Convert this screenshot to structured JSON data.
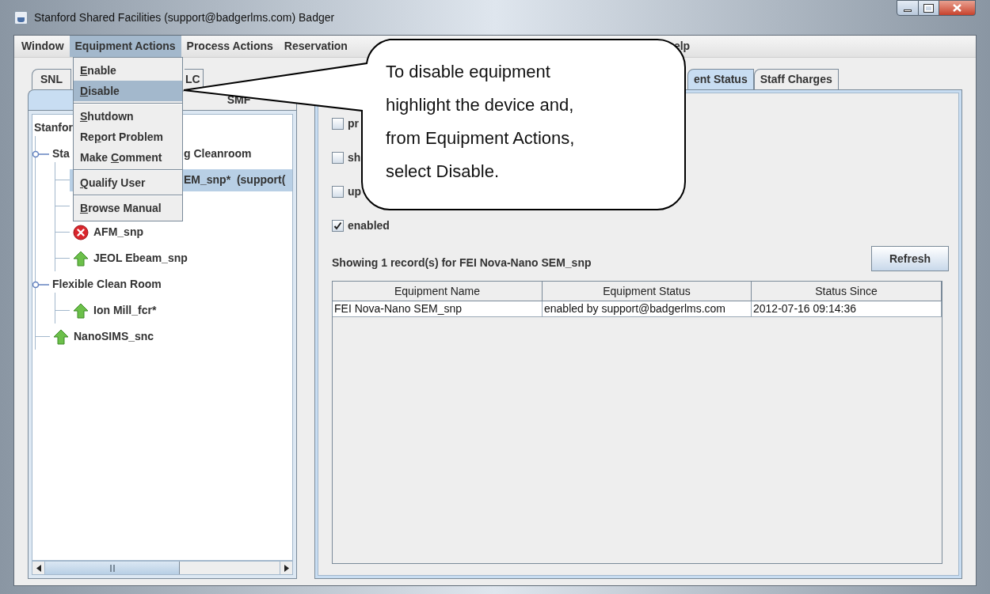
{
  "window": {
    "title": "Stanford Shared Facilities (support@badgerlms.com) Badger"
  },
  "menu_bar": [
    {
      "label": "Window",
      "selected": false
    },
    {
      "label": "Equipment Actions",
      "selected": true
    },
    {
      "label": "Process Actions",
      "selected": false
    },
    {
      "label": "Reservation",
      "selected": false
    },
    {
      "kind": "covered"
    },
    {
      "label": "elp",
      "selected": false
    }
  ],
  "equipment_menu": [
    {
      "label_parts": [
        {
          "text": "E",
          "underlined": true
        },
        {
          "text": "nable",
          "underlined": false
        }
      ],
      "selected": false,
      "separator_before": false
    },
    {
      "label_parts": [
        {
          "text": "D",
          "underlined": true
        },
        {
          "text": "isable",
          "underlined": false
        }
      ],
      "selected": true,
      "separator_before": false
    },
    {
      "label_parts": [
        {
          "text": "S",
          "underlined": true
        },
        {
          "text": "hutdown",
          "underlined": false
        }
      ],
      "selected": false,
      "separator_before": true
    },
    {
      "label_parts": [
        {
          "text": "Re",
          "underlined": false
        },
        {
          "text": "p",
          "underlined": true
        },
        {
          "text": "ort Problem",
          "underlined": false
        }
      ],
      "selected": false,
      "separator_before": false
    },
    {
      "label_parts": [
        {
          "text": "Make ",
          "underlined": false
        },
        {
          "text": "C",
          "underlined": true
        },
        {
          "text": "omment",
          "underlined": false
        }
      ],
      "selected": false,
      "separator_before": false
    },
    {
      "label_parts": [
        {
          "text": "Q",
          "underlined": true
        },
        {
          "text": "ualify User",
          "underlined": false
        }
      ],
      "selected": false,
      "separator_before": true
    },
    {
      "label_parts": [
        {
          "text": "B",
          "underlined": true
        },
        {
          "text": "rowse Manual",
          "underlined": false
        }
      ],
      "selected": false,
      "separator_before": true
    }
  ],
  "site_tabs": [
    {
      "tabs": [
        {
          "label": "SNL",
          "selected": false
        },
        {
          "label": "LC",
          "selected": false
        }
      ]
    },
    {
      "tabs": [
        {
          "selected": true
        },
        {
          "label": "SMF",
          "selected": false
        }
      ]
    }
  ],
  "tree": {
    "label": "Stanfor",
    "children": [
      {
        "label": "Sta",
        "label_tail": "g Cleanroom",
        "expanded": true,
        "children": [
          {
            "kind": "covered",
            "label_tail": "EM_snp*  (support(",
            "selected": true
          },
          {
            "kind": "covered",
            "selected": false
          },
          {
            "kind": "down",
            "label": "AFM_snp",
            "selected": false
          },
          {
            "kind": "up",
            "label": "JEOL Ebeam_snp",
            "selected": false
          }
        ]
      },
      {
        "label": "Flexible Clean Room",
        "expanded": true,
        "children": [
          {
            "kind": "up",
            "label": "Ion Mill_fcr*",
            "selected": false
          }
        ]
      },
      {
        "kind": "up",
        "label": "NanoSIMS_snc",
        "selected": false
      }
    ]
  },
  "detail_tabs": [
    {
      "label": "ent Status",
      "selected": true
    },
    {
      "label": "Staff Charges",
      "selected": false
    }
  ],
  "status_flags": [
    {
      "label": "pr",
      "checked": false
    },
    {
      "label": "sh",
      "checked": false
    },
    {
      "label": "up",
      "checked": false
    },
    {
      "label": "enabled",
      "checked": true
    }
  ],
  "record_summary": "Showing 1 record(s) for FEI Nova-Nano SEM_snp",
  "refresh_button": "Refresh",
  "table": {
    "columns": [
      "Equipment Name",
      "Equipment Status",
      "Status Since"
    ],
    "rows": [
      [
        "FEI Nova-Nano SEM_snp",
        "enabled by support@badgerlms.com",
        "2012-07-16 09:14:36"
      ]
    ]
  },
  "callout": {
    "text": "To disable equipment highlight the device and, from Equipment Actions, select Disable."
  }
}
